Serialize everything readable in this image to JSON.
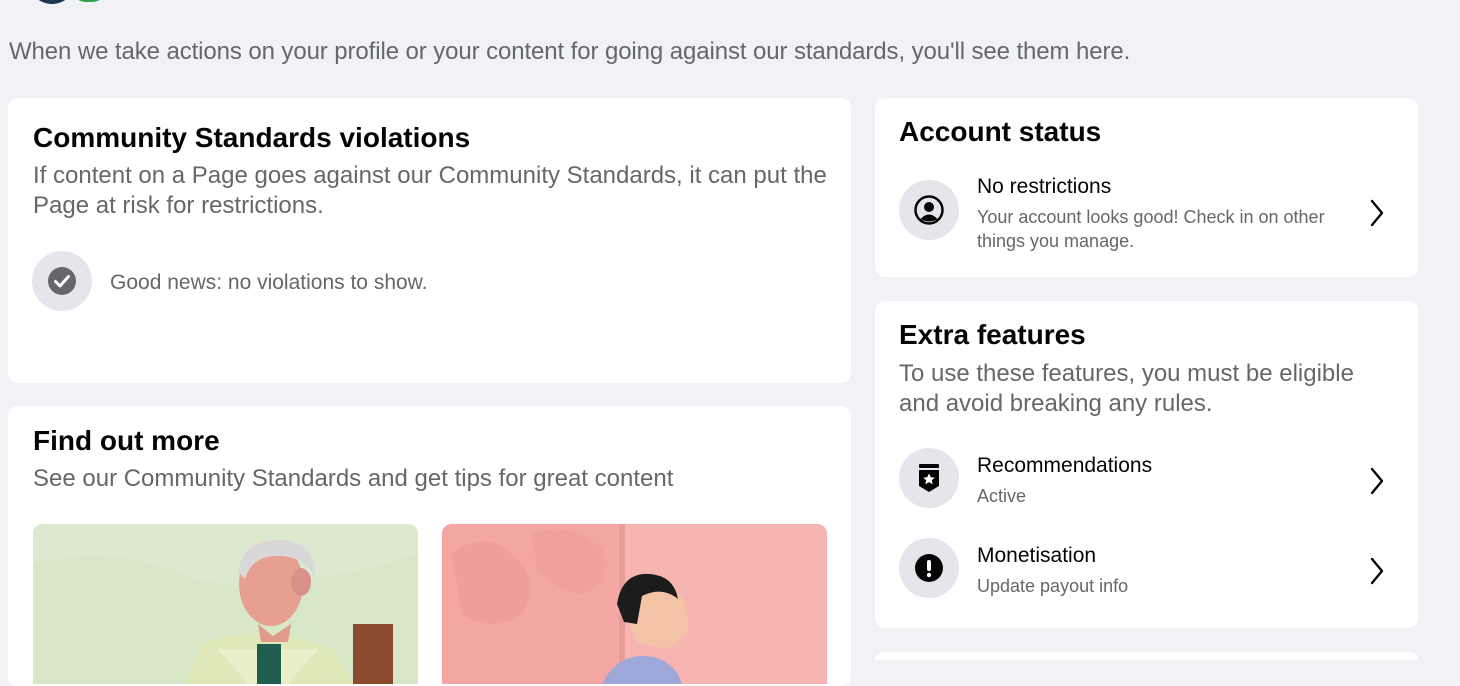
{
  "intro_text": "When we take actions on your profile or your content for going against our standards, you'll see them here.",
  "violations": {
    "title": "Community Standards violations",
    "description": "If content on a Page goes against our Community Standards, it can put the Page at risk for restrictions.",
    "status_text": "Good news: no violations to show.",
    "icon": "check-circle-icon"
  },
  "find_out_more": {
    "title": "Find out more",
    "description": "See our Community Standards and get tips for great content"
  },
  "account_status": {
    "title": "Account status",
    "item": {
      "title": "No restrictions",
      "subtitle": "Your account looks good! Check in on other things you manage.",
      "icon": "person-circle-icon"
    }
  },
  "extra_features": {
    "title": "Extra features",
    "description": "To use these features, you must be eligible and avoid breaking any rules.",
    "items": [
      {
        "title": "Recommendations",
        "subtitle": "Active",
        "icon": "badge-star-icon"
      },
      {
        "title": "Monetisation",
        "subtitle": "Update payout info",
        "icon": "alert-circle-icon"
      }
    ]
  },
  "colors": {
    "background": "#f0f2f5",
    "card": "#ffffff",
    "primary_text": "#050505",
    "secondary_text": "#65676b",
    "icon_bg": "#e4e6eb"
  }
}
